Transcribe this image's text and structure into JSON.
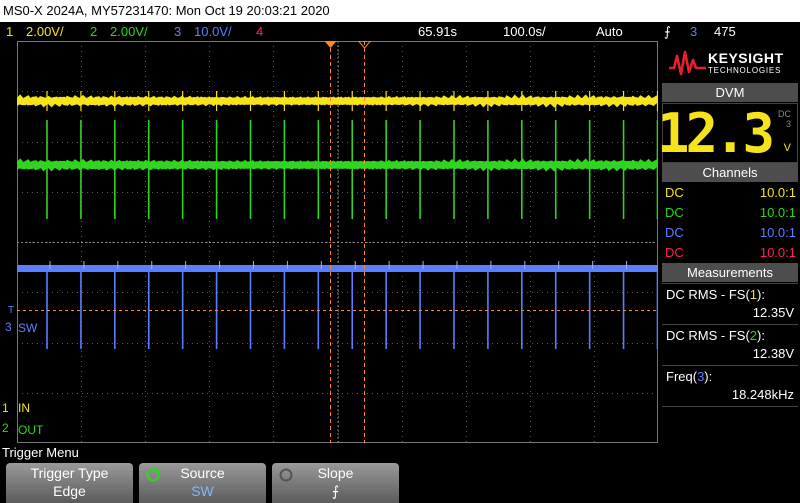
{
  "title_bar": "MS0-X 2024A, MY57231470: Mon Oct 19 20:03:21 2020",
  "channel_bar": {
    "ch1": {
      "num": "1",
      "scale": "2.00V/",
      "color": "#f7e31a"
    },
    "ch2": {
      "num": "2",
      "scale": "2.00V/",
      "color": "#2fd51f"
    },
    "ch3": {
      "num": "3",
      "scale": "10.0V/",
      "color": "#5b7dff"
    },
    "ch4": {
      "num": "4",
      "color": "#ff2255"
    },
    "timebase": "65.91s",
    "delay": "100.0s/",
    "mode": "Auto",
    "trigger_slope": "⨍",
    "trigger_source": "3",
    "trigger_level": "475"
  },
  "markers": {
    "ch1_label": "IN",
    "ch2_label": "OUT",
    "ch3_label": "SW",
    "ch1_num": "1",
    "ch2_num": "2",
    "ch3_num": "3",
    "trig_t": "T"
  },
  "brand": {
    "name": "KEYSIGHT",
    "sub": "TECHNOLOGIES"
  },
  "dvm": {
    "header": "DVM",
    "value": "12.3",
    "unit": "V",
    "caption_top": "DC",
    "caption_bot": "3"
  },
  "channels": {
    "header": "Channels",
    "rows": [
      {
        "coupling": "DC",
        "probe": "10.0:1",
        "color": "#f7e31a"
      },
      {
        "coupling": "DC",
        "probe": "10.0:1",
        "color": "#2fd51f"
      },
      {
        "coupling": "DC",
        "probe": "10.0:1",
        "color": "#5b7dff"
      },
      {
        "coupling": "DC",
        "probe": "10.0:1",
        "color": "#ff2255"
      }
    ]
  },
  "measurements": {
    "header": "Measurements",
    "items": [
      {
        "label_pre": "DC RMS - FS(",
        "label_ch": "1",
        "label_post": "):",
        "value": "12.35V",
        "ch_color": "#f7e31a"
      },
      {
        "label_pre": "DC RMS - FS(",
        "label_ch": "2",
        "label_post": "):",
        "value": "12.38V",
        "ch_color": "#2fd51f"
      },
      {
        "label_pre": "Freq(",
        "label_ch": "3",
        "label_post": "):",
        "value": "18.248kHz",
        "ch_color": "#5b7dff"
      }
    ]
  },
  "menu": {
    "title": "Trigger Menu",
    "softkeys": [
      {
        "label": "Trigger Type",
        "value": "Edge"
      },
      {
        "label": "Source",
        "value": "SW"
      },
      {
        "label": "Slope",
        "value": "⨍"
      }
    ]
  },
  "colors": {
    "grid": "#5a5a5a",
    "trigger": "#ff8c1a",
    "softkey_value": "#7fb8ff"
  }
}
